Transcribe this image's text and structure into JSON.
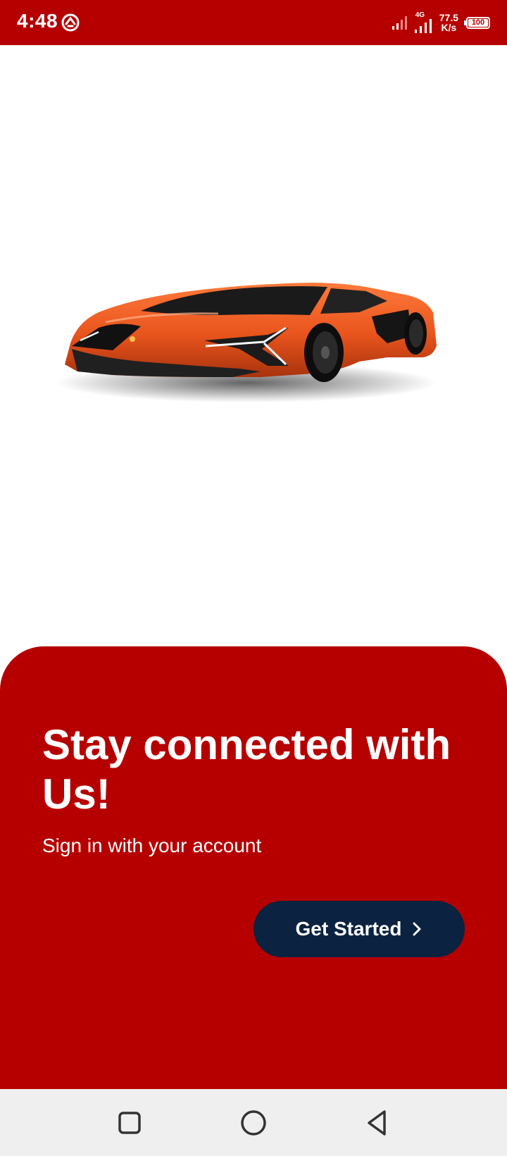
{
  "status_bar": {
    "time": "4:48",
    "network_type": "4G",
    "net_speed_value": "77.5",
    "net_speed_unit": "K/s",
    "battery_level": "100",
    "app_icon": "sync-circle-icon",
    "background_color": "#b60000"
  },
  "hero": {
    "image_icon": "sports-car-illustration",
    "car_color": "#e8541d"
  },
  "onboarding": {
    "headline": "Stay connected with Us!",
    "subtitle": "Sign in with your account",
    "cta_label": "Get Started",
    "cta_icon": "chevron-right-icon",
    "panel_color": "#b60000",
    "button_color": "#0b2240"
  },
  "nav_bar": {
    "buttons": [
      "recent-apps-icon",
      "home-icon",
      "back-icon"
    ]
  }
}
